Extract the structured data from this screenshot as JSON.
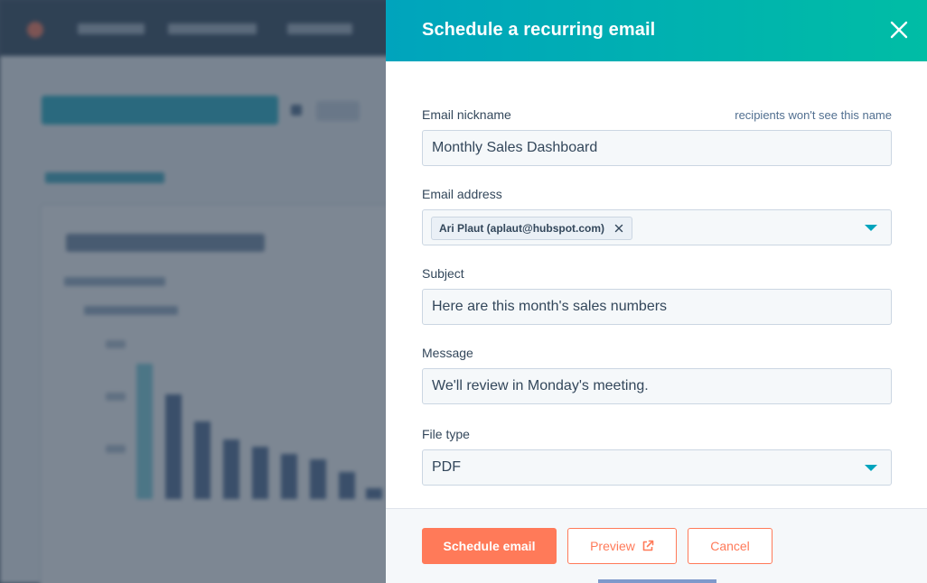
{
  "modal": {
    "title": "Schedule a recurring email",
    "close_icon": "close-icon"
  },
  "form": {
    "nickname": {
      "label": "Email nickname",
      "hint": "recipients won't see this name",
      "value": "Monthly Sales Dashboard"
    },
    "email_address": {
      "label": "Email address",
      "tags": [
        {
          "label": "Ari Plaut (aplaut@hubspot.com)",
          "remove_icon": "close-icon"
        }
      ],
      "caret_icon": "caret-down-icon"
    },
    "subject": {
      "label": "Subject",
      "value": "Here are this month's sales numbers"
    },
    "message": {
      "label": "Message",
      "value": "We'll review in Monday's meeting."
    },
    "file_type": {
      "label": "File type",
      "selected": "PDF",
      "caret_icon": "caret-down-icon"
    }
  },
  "footer": {
    "schedule_label": "Schedule email",
    "preview_label": "Preview",
    "preview_icon": "external-link-icon",
    "cancel_label": "Cancel"
  },
  "colors": {
    "header_gradient_start": "#00a4bd",
    "header_gradient_end": "#00bda5",
    "primary": "#ff7a59",
    "text": "#33475b",
    "input_bg": "#f5f8fa",
    "border": "#cbd6e2"
  }
}
